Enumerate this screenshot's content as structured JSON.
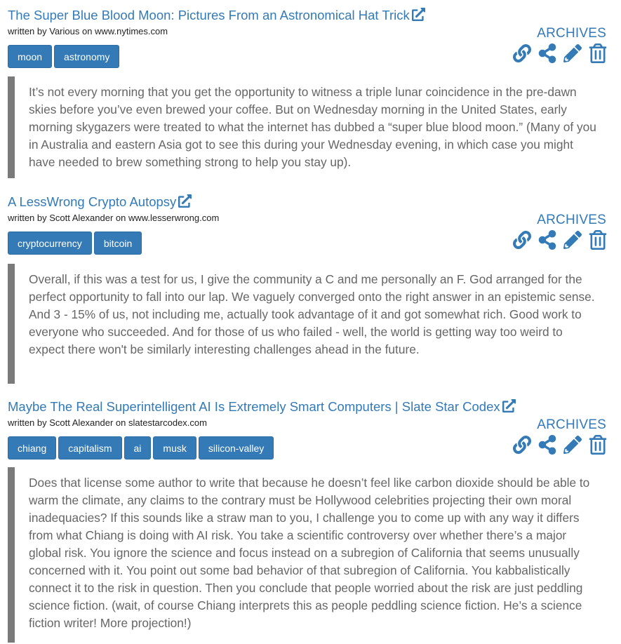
{
  "articles": [
    {
      "title": "The Super Blue Blood Moon: Pictures From an Astronomical Hat Trick",
      "byline": "written by Various on www.nytimes.com",
      "archives_label": "ARCHIVES",
      "tags": [
        "moon",
        "astronomy"
      ],
      "quote": "It’s not every morning that you get the opportunity to witness a triple lunar coincidence in the pre-dawn skies before you’ve even brewed your coffee. But on Wednesday morning in the United States, early morning skygazers were treated to what the internet has dubbed a “super blue blood moon.” (Many of you in Australia and eastern Asia got to see this during your Wednesday evening, in which case you might have needed to brew something strong to help you stay up)."
    },
    {
      "title": "A LessWrong Crypto Autopsy",
      "byline": "written by Scott Alexander on www.lesserwrong.com",
      "archives_label": "ARCHIVES",
      "tags": [
        "cryptocurrency",
        "bitcoin"
      ],
      "quote": "Overall, if this was a test for us, I give the community a C and me personally an F. God arranged for the perfect opportunity to fall into our lap. We vaguely converged onto the right answer in an epistemic sense. And 3 - 15% of us, not including me, actually took advantage of it and got somewhat rich. Good work to everyone who succeeded. And for those of us who failed - well, the world is getting way too weird to expect there won't be similarly interesting challenges ahead in the future."
    },
    {
      "title": "Maybe The Real Superintelligent AI Is Extremely Smart Computers | Slate Star Codex",
      "byline": "written by Scott Alexander on slatestarcodex.com",
      "archives_label": "ARCHIVES",
      "tags": [
        "chiang",
        "capitalism",
        "ai",
        "musk",
        "silicon-valley"
      ],
      "quote": "Does that license some author to write that because he doesn’t feel like carbon dioxide should be able to warm the climate, any claims to the contrary must be Hollywood celebrities projecting their own moral inadequacies? If this sounds like a straw man to you, I challenge you to come up with any way it differs from what Chiang is doing with AI risk. You take a scientific controversy over whether there’s a major global risk. You ignore the science and focus instead on a subregion of California that seems unusually concerned with it. You point out some bad behavior of that subregion of California. You kabbalistically connect it to the risk in question. Then you conclude that people worried about the risk are just peddling science fiction. (wait, of course Chiang interprets this as people peddling science fiction. He’s a science fiction writer! More projection!)"
    }
  ],
  "icons": {
    "external": "external-link-icon",
    "actions": [
      "link-icon",
      "share-icon",
      "pencil-icon",
      "trash-icon"
    ]
  },
  "colors": {
    "accent": "#337ab7",
    "quote_text": "#666666",
    "quote_border": "#7a7a7a"
  }
}
